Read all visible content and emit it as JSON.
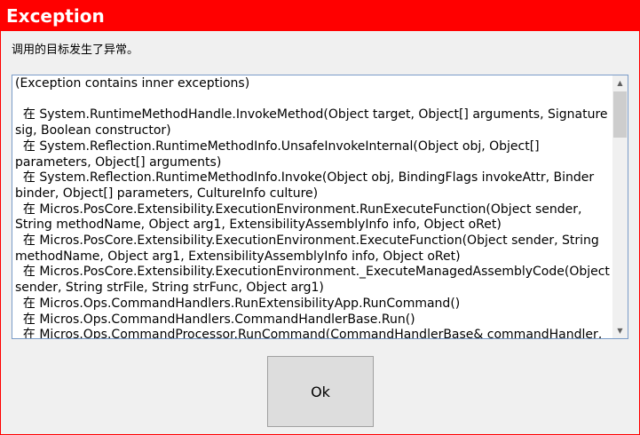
{
  "window": {
    "title": "Exception"
  },
  "message": "调用的目标发生了异常。",
  "details": "(Exception contains inner exceptions)\n\n  在 System.RuntimeMethodHandle.InvokeMethod(Object target, Object[] arguments, Signature sig, Boolean constructor)\n  在 System.Reflection.RuntimeMethodInfo.UnsafeInvokeInternal(Object obj, Object[] parameters, Object[] arguments)\n  在 System.Reflection.RuntimeMethodInfo.Invoke(Object obj, BindingFlags invokeAttr, Binder binder, Object[] parameters, CultureInfo culture)\n  在 Micros.PosCore.Extensibility.ExecutionEnvironment.RunExecuteFunction(Object sender, String methodName, Object arg1, ExtensibilityAssemblyInfo info, Object oRet)\n  在 Micros.PosCore.Extensibility.ExecutionEnvironment.ExecuteFunction(Object sender, String methodName, Object arg1, ExtensibilityAssemblyInfo info, Object oRet)\n  在 Micros.PosCore.Extensibility.ExecutionEnvironment._ExecuteManagedAssemblyCode(Object sender, String strFile, String strFunc, Object arg1)\n  在 Micros.Ops.CommandHandlers.RunExtensibilityApp.RunCommand()\n  在 Micros.Ops.CommandHandlers.CommandHandlerBase.Run()\n  在 Micros.Ops.CommandProcessor.RunCommand(CommandHandlerBase& commandHandler,",
  "scrollbar": {
    "up_icon": "▲",
    "down_icon": "▼"
  },
  "buttons": {
    "ok_label": "Ok"
  },
  "colors": {
    "titlebar": "#ff0000",
    "dialog_bg": "#f0f0f0"
  }
}
